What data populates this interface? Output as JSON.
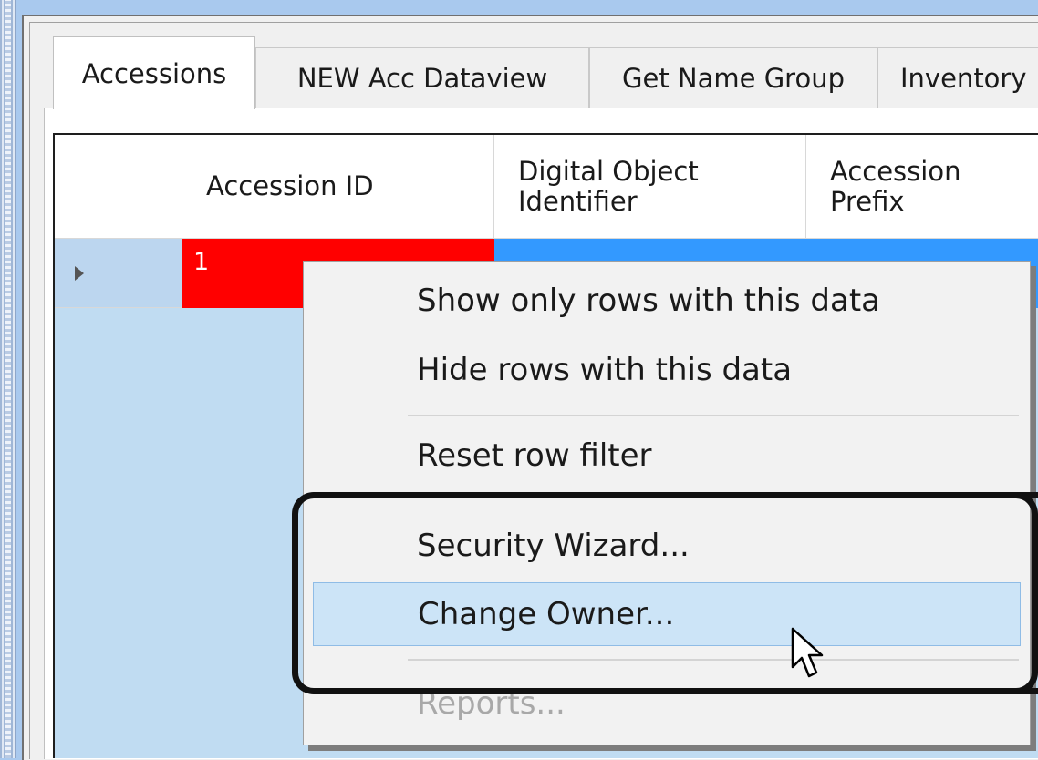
{
  "tabs": [
    {
      "label": "Accessions",
      "active": true
    },
    {
      "label": "NEW Acc Dataview",
      "active": false
    },
    {
      "label": "Get Name Group",
      "active": false
    },
    {
      "label": "Inventory",
      "active": false
    }
  ],
  "grid": {
    "columns": [
      {
        "line1": "Accession ID",
        "line2": ""
      },
      {
        "line1": "Digital Object",
        "line2": "Identifier"
      },
      {
        "line1": "Accession",
        "line2": "Prefix"
      }
    ],
    "rows": [
      {
        "accession_id": "1",
        "doi": "",
        "prefix": ""
      }
    ],
    "colors": {
      "selected_red": "#ff0000",
      "selected_blue": "#3399ff",
      "grid_bg": "#c0dcf2"
    }
  },
  "context_menu": {
    "items": [
      {
        "label": "Show only rows with this data",
        "state": "normal"
      },
      {
        "label": "Hide rows with this data",
        "state": "normal"
      },
      {
        "label": "Reset row filter",
        "state": "normal"
      },
      {
        "label": "Security Wizard...",
        "state": "normal"
      },
      {
        "label": "Change Owner...",
        "state": "highlighted"
      },
      {
        "label": "Reports...",
        "state": "disabled"
      }
    ],
    "callout_color": "#111111",
    "highlight_color": "#cce4f7"
  },
  "icons": {
    "row_indicator": "row-selector-arrow-icon",
    "cursor": "mouse-pointer-icon"
  }
}
